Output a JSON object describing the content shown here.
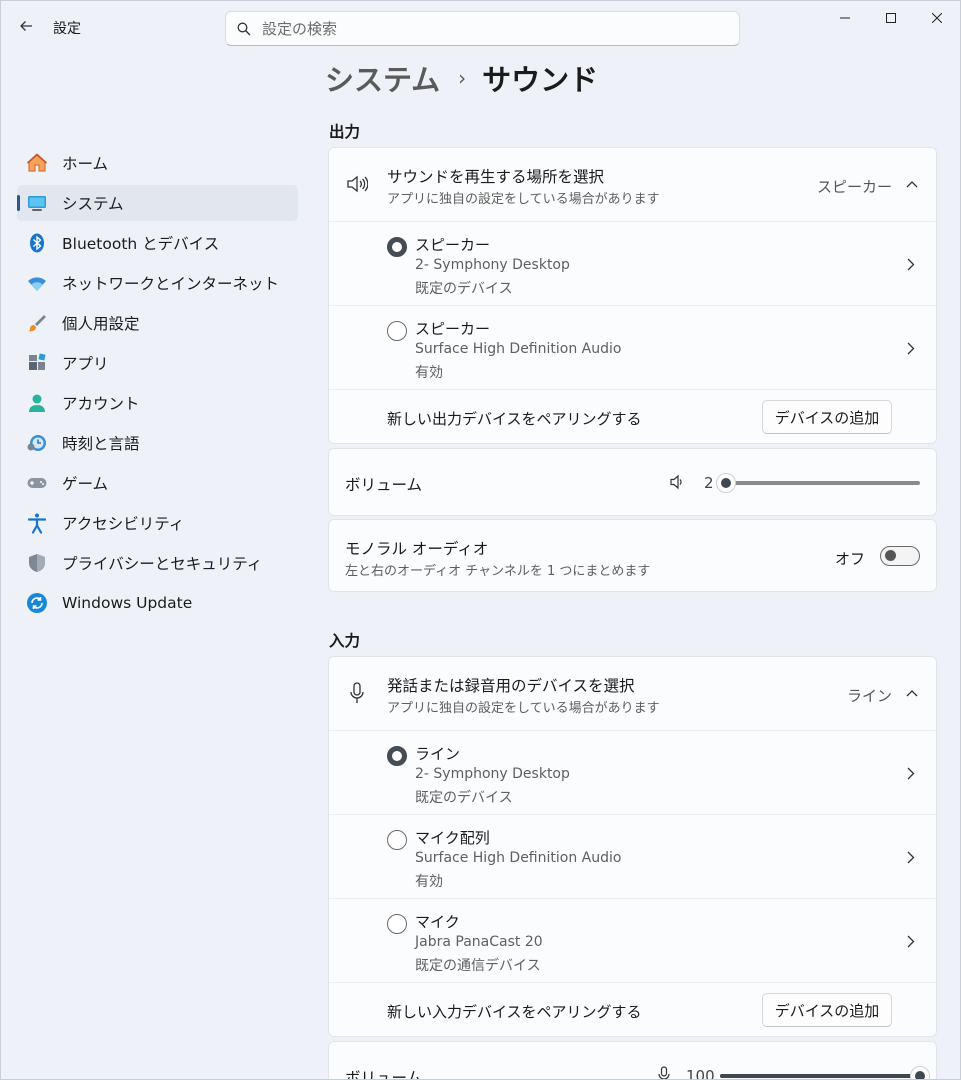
{
  "app": {
    "title": "設定",
    "search_placeholder": "設定の検索"
  },
  "breadcrumb": {
    "parent": "システム",
    "separator": "›",
    "current": "サウンド"
  },
  "sidebar": {
    "items": [
      {
        "label": "ホーム",
        "icon": "home-icon"
      },
      {
        "label": "システム",
        "icon": "system-icon",
        "active": true
      },
      {
        "label": "Bluetooth とデバイス",
        "icon": "bluetooth-icon"
      },
      {
        "label": "ネットワークとインターネット",
        "icon": "wifi-icon"
      },
      {
        "label": "個人用設定",
        "icon": "brush-icon"
      },
      {
        "label": "アプリ",
        "icon": "apps-icon"
      },
      {
        "label": "アカウント",
        "icon": "account-icon"
      },
      {
        "label": "時刻と言語",
        "icon": "time-language-icon"
      },
      {
        "label": "ゲーム",
        "icon": "gamepad-icon"
      },
      {
        "label": "アクセシビリティ",
        "icon": "accessibility-icon"
      },
      {
        "label": "プライバシーとセキュリティ",
        "icon": "shield-icon"
      },
      {
        "label": "Windows Update",
        "icon": "update-icon"
      }
    ]
  },
  "output": {
    "section_title": "出力",
    "header": {
      "title": "サウンドを再生する場所を選択",
      "subtitle": "アプリに独自の設定をしている場合があります",
      "value": "スピーカー"
    },
    "devices": [
      {
        "name": "スピーカー",
        "desc": "2- Symphony Desktop",
        "status": "既定のデバイス",
        "selected": true
      },
      {
        "name": "スピーカー",
        "desc": "Surface High Definition Audio",
        "status": "有効",
        "selected": false
      }
    ],
    "pair": {
      "label": "新しい出力デバイスをペアリングする",
      "button": "デバイスの追加"
    },
    "volume": {
      "label": "ボリューム",
      "value": "2",
      "level": 0.02
    },
    "mono": {
      "title": "モノラル オーディオ",
      "subtitle": "左と右のオーディオ チャンネルを 1 つにまとめます",
      "state": "オフ"
    }
  },
  "input": {
    "section_title": "入力",
    "header": {
      "title": "発話または録音用のデバイスを選択",
      "subtitle": "アプリに独自の設定をしている場合があります",
      "value": "ライン"
    },
    "devices": [
      {
        "name": "ライン",
        "desc": "2- Symphony Desktop",
        "status": "既定のデバイス",
        "selected": true
      },
      {
        "name": "マイク配列",
        "desc": "Surface High Definition Audio",
        "status": "有効",
        "selected": false
      },
      {
        "name": "マイク",
        "desc": "Jabra PanaCast 20",
        "status": "既定の通信デバイス",
        "selected": false
      }
    ],
    "pair": {
      "label": "新しい入力デバイスをペアリングする",
      "button": "デバイスの追加"
    },
    "volume": {
      "label": "ボリューム",
      "value": "100",
      "level": 1.0
    }
  },
  "colors": {
    "accent": "#3d4853",
    "window_bg": "#eef2f8",
    "card_bg": "#fbfcfd"
  }
}
